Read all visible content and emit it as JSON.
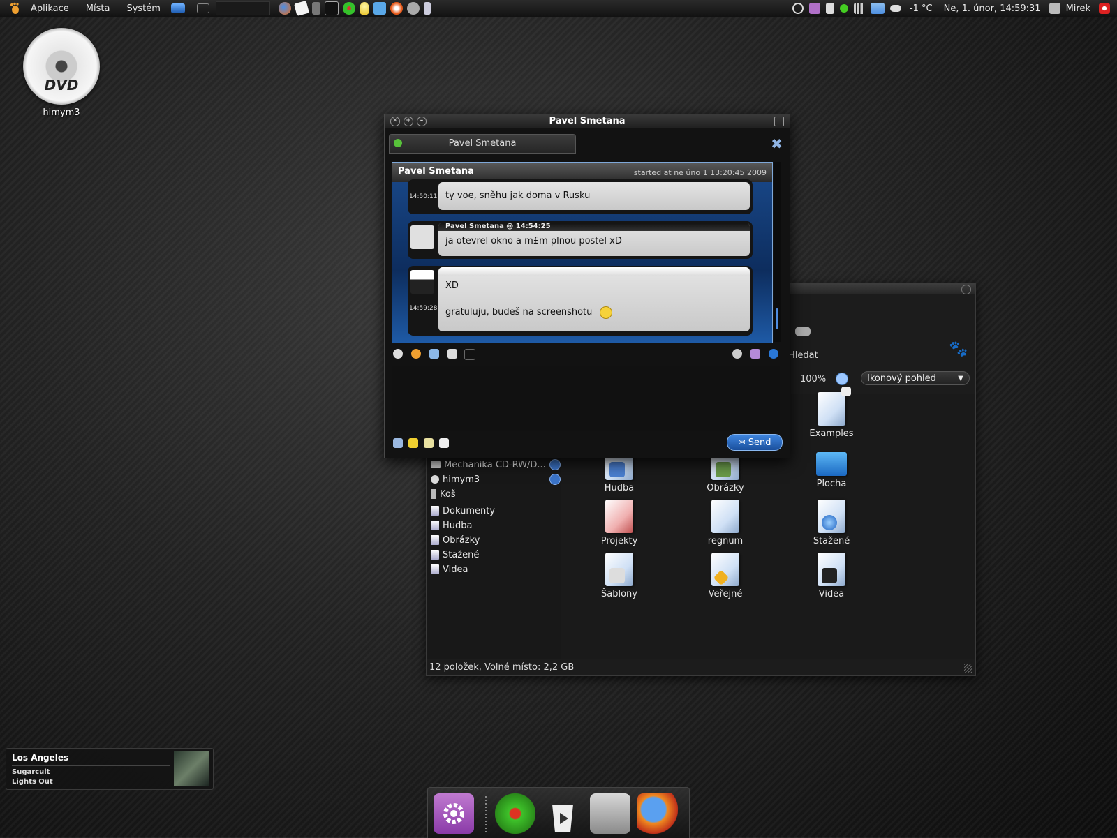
{
  "top_panel": {
    "menu": [
      "Aplikace",
      "Místa",
      "Systém"
    ],
    "weather": "-1 °C",
    "datetime": "Ne,  1. únor, 14:59:31",
    "user": "Mirek"
  },
  "desktop": {
    "dvd_label": "himym3",
    "dvd_disc_text": "DVD"
  },
  "chat": {
    "window_title": "Pavel Smetana",
    "tab_label": "Pavel Smetana",
    "conv_name": "Pavel Smetana",
    "started": "started at ne úno 1 13:20:45 2009",
    "messages": [
      {
        "time": "14:50:11",
        "header": "",
        "lines": [
          "ty voe, sněhu jak doma v Rusku"
        ]
      },
      {
        "time": "",
        "header": "Pavel Smetana @ 14:54:25",
        "lines": [
          "ja otevrel okno a m£m plnou postel xD"
        ]
      },
      {
        "time": "14:59:28",
        "header": "",
        "lines": [
          "XD",
          "gratuluju, budeš na screenshotu"
        ]
      }
    ],
    "send_label": "Send",
    "send_icon": "envelope-icon"
  },
  "file_manager": {
    "search_label": "Hledat",
    "zoom": "100%",
    "view_mode": "Ikonový pohled",
    "sidebar": [
      {
        "label": "Mechanika CD-RW/D...",
        "eject": true
      },
      {
        "label": "himym3",
        "eject": true
      },
      {
        "label": "Koš",
        "eject": false
      },
      {
        "label": "Dokumenty",
        "eject": false
      },
      {
        "label": "Hudba",
        "eject": false
      },
      {
        "label": "Obrázky",
        "eject": false
      },
      {
        "label": "Stažené",
        "eject": false
      },
      {
        "label": "Videa",
        "eject": false
      }
    ],
    "items": [
      "Examples",
      "Hudba",
      "Obrázky",
      "Plocha",
      "Projekty",
      "regnum",
      "Stažené",
      "Šablony",
      "Veřejné",
      "Videa"
    ],
    "status": "12 položek, Volné místo: 2,2 GB"
  },
  "music": {
    "title": "Los Angeles",
    "artist": "Sugarcult",
    "album": "Lights Out"
  },
  "colors": {
    "accent_blue": "#3f86e0",
    "status_green": "#58c23a"
  }
}
